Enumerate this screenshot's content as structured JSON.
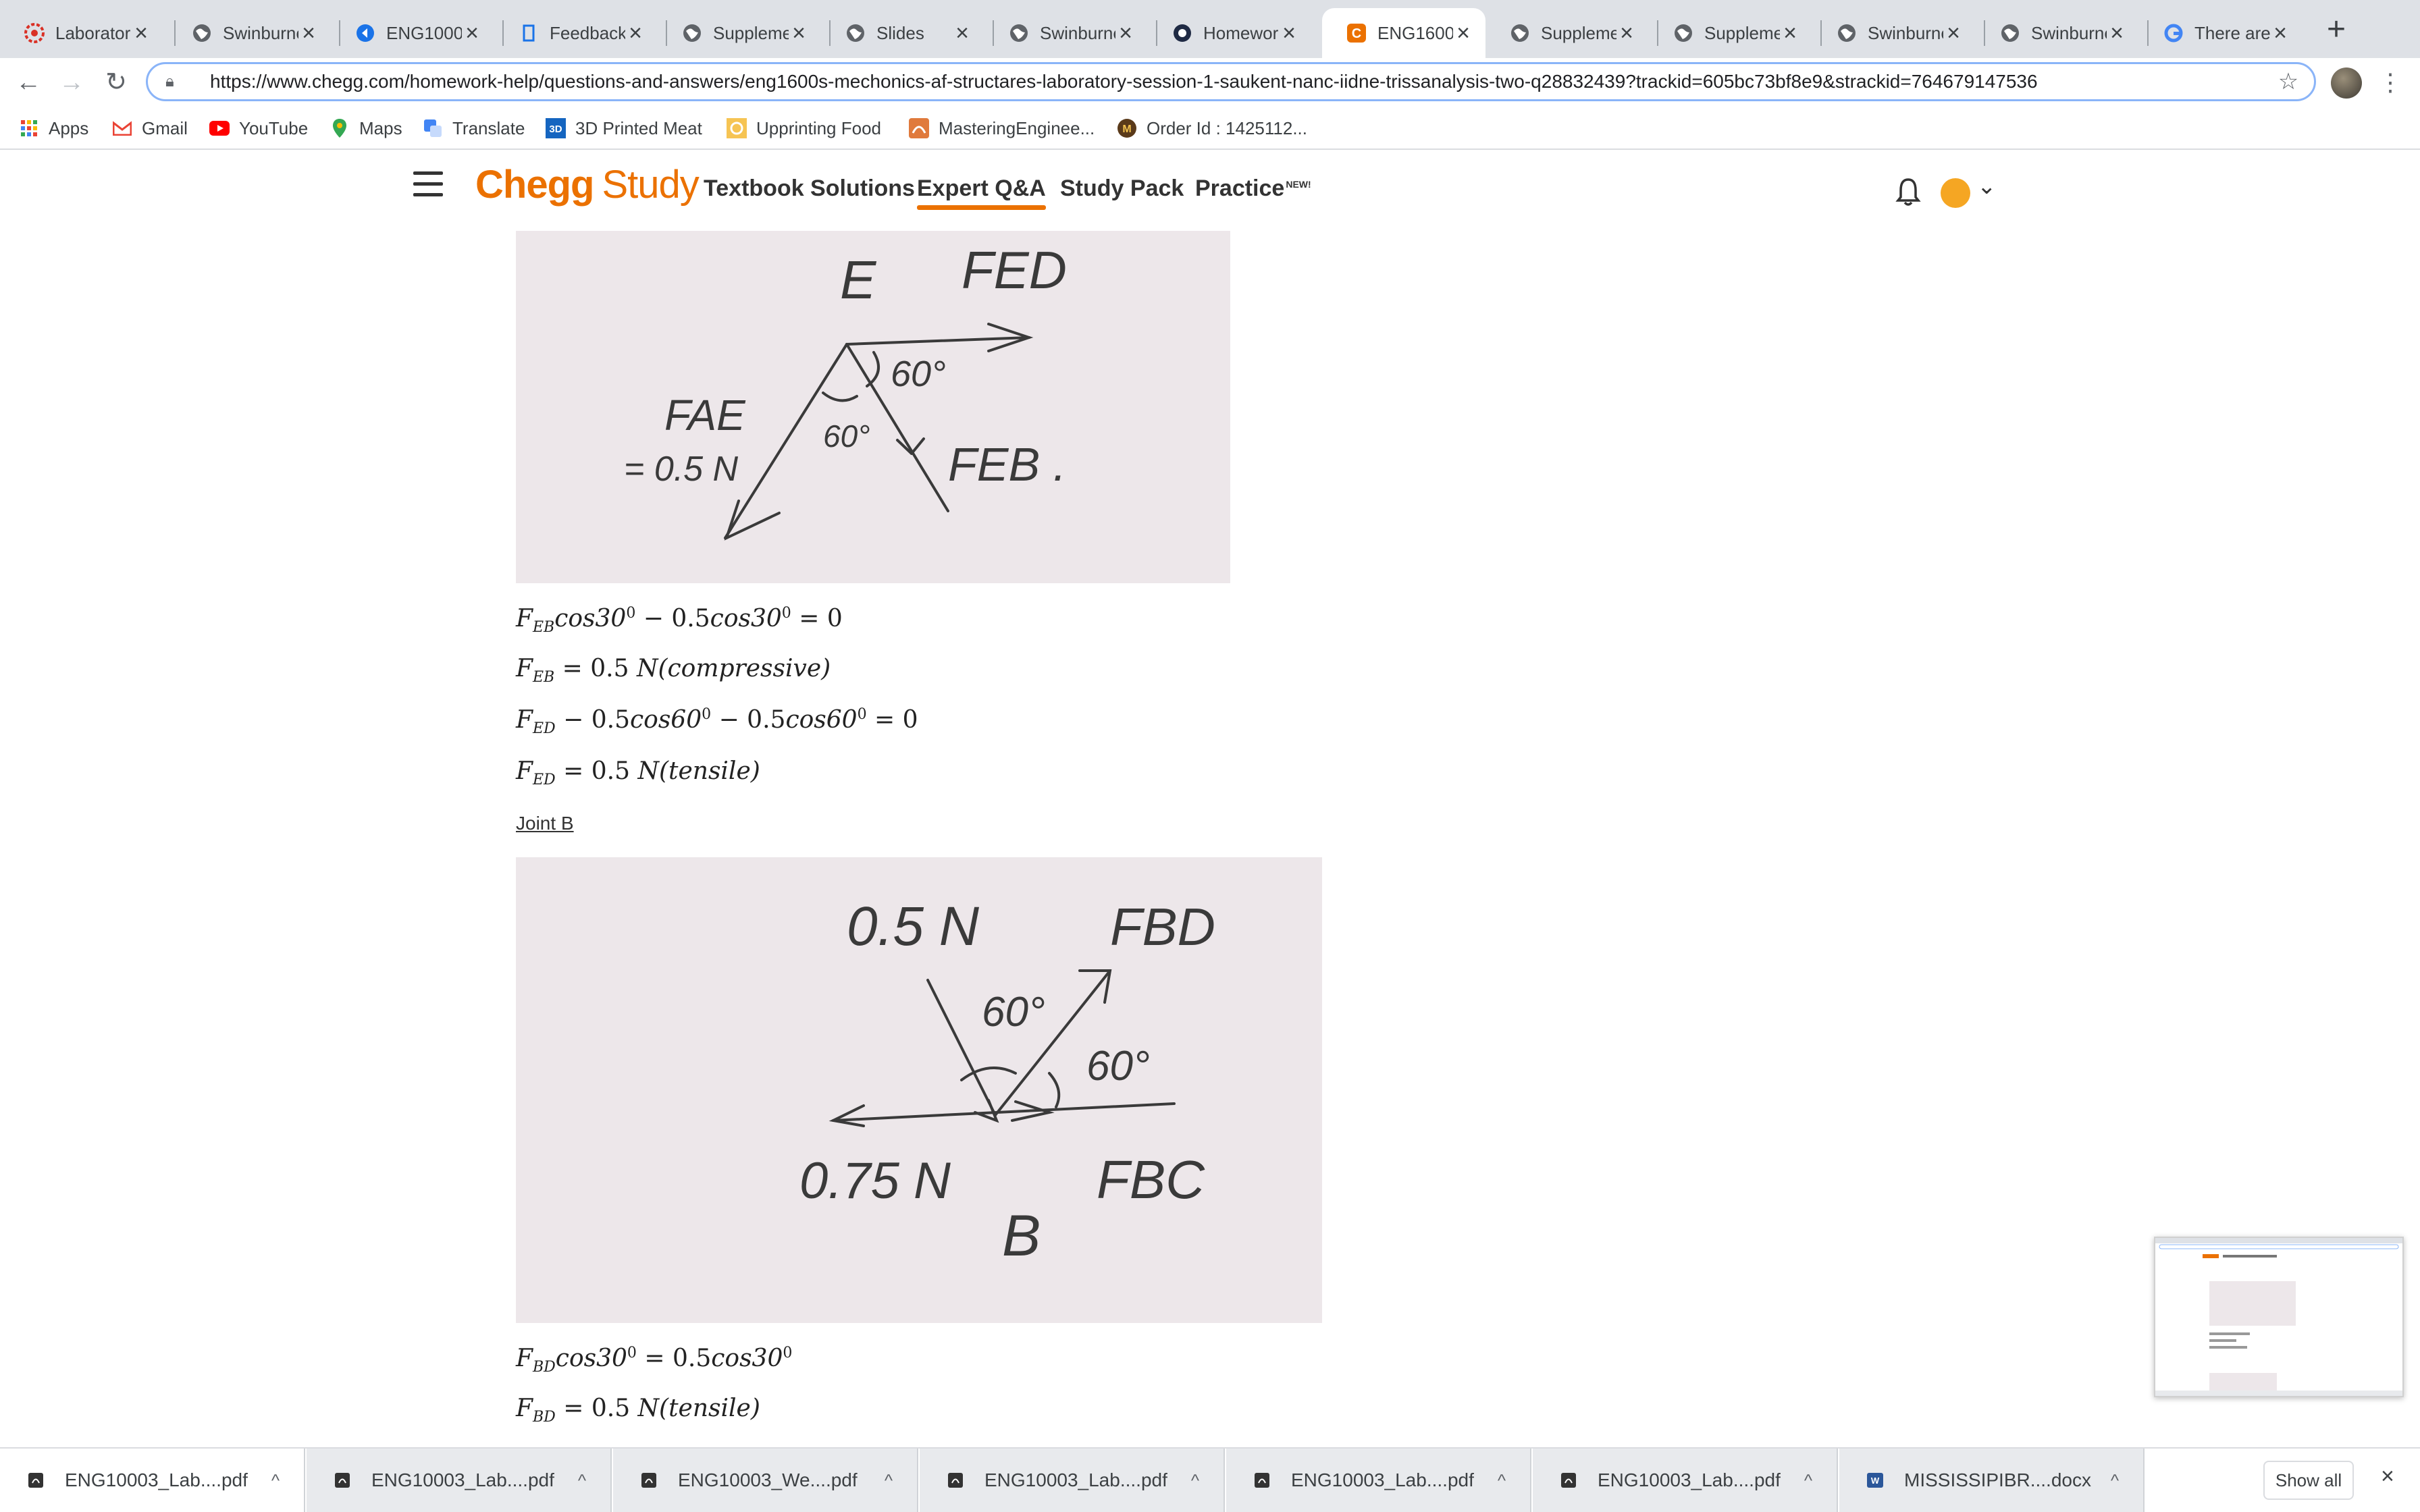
{
  "browser": {
    "tabs": [
      {
        "title": "Laborator",
        "icon": "gear-red-icon"
      },
      {
        "title": "Swinburne",
        "icon": "globe-icon"
      },
      {
        "title": "ENG1000",
        "icon": "arrow-circle-icon"
      },
      {
        "title": "Feedback",
        "icon": "feedback-icon"
      },
      {
        "title": "Suppleme",
        "icon": "globe-icon"
      },
      {
        "title": "Slides",
        "icon": "globe-icon"
      },
      {
        "title": "Swinburne",
        "icon": "globe-icon"
      },
      {
        "title": "Homework",
        "icon": "homework-icon"
      },
      {
        "title": "ENG1600",
        "icon": "chegg-icon"
      },
      {
        "title": "Suppleme",
        "icon": "globe-icon"
      },
      {
        "title": "Suppleme",
        "icon": "globe-icon"
      },
      {
        "title": "Swinburne",
        "icon": "globe-icon"
      },
      {
        "title": "Swinburne",
        "icon": "globe-icon"
      },
      {
        "title": "There are",
        "icon": "google-icon"
      }
    ],
    "url": "https://www.chegg.com/homework-help/questions-and-answers/eng1600s-mechonics-af-structares-laboratory-session-1-saukent-nanc-iidne-trissanalysis-two-q28832439?trackid=605bc73bf8e9&strackid=764679147536",
    "bookmarks": [
      "Apps",
      "Gmail",
      "YouTube",
      "Maps",
      "Translate",
      "3D Printed Meat",
      "Upprinting Food",
      "MasteringEnginee...",
      "Order Id : 1425112..."
    ]
  },
  "chegg": {
    "logo_main": "Chegg",
    "logo_sub": "Study",
    "nav": {
      "textbook": "Textbook Solutions",
      "expert": "Expert Q&A",
      "studypack": "Study Pack",
      "practice": "Practice",
      "practice_badge": "NEW!"
    },
    "accent": "#eb7100"
  },
  "content": {
    "sketch1_labels": {
      "E": "E",
      "FED": "FED",
      "angle_top": "60°",
      "angle_left": "60°",
      "FAE": "FAE",
      "FAE_val": "= 0.5 N",
      "FEB": "FEB ."
    },
    "eq1": {
      "a": "F",
      "a_sub": "EB",
      "b": "cos30",
      "b_sup": "0",
      "c": " − 0.5",
      "d": "cos30",
      "d_sup": "0",
      "e": " = 0"
    },
    "eq2": {
      "a": "F",
      "a_sub": "EB",
      "b": " = 0.5 ",
      "c": "N",
      "d": "(compressive)"
    },
    "eq3": {
      "a": "F",
      "a_sub": "ED",
      "b": " − 0.5",
      "c": "cos60",
      "c_sup": "0",
      "d": " − 0.5",
      "e": "cos60",
      "e_sup": "0",
      "f": " = 0"
    },
    "eq4": {
      "a": "F",
      "a_sub": "ED",
      "b": " = 0.5 ",
      "c": "N",
      "d": "(tensile)"
    },
    "joint_b": "Joint B",
    "sketch2_labels": {
      "load": "0.5 N",
      "FBD": "FBD",
      "angle1": "60°",
      "angle2": "60°",
      "left": "0.75 N",
      "FBC": "FBC",
      "B": "B"
    },
    "eq5": {
      "a": "F",
      "a_sub": "BD",
      "b": "cos30",
      "b_sup": "0",
      "c": " = 0.5",
      "d": "cos30",
      "d_sup": "0"
    },
    "eq6": {
      "a": "F",
      "a_sub": "BD",
      "b": " = 0.5 ",
      "c": "N",
      "d": "(tensile)"
    }
  },
  "downloads": {
    "items": [
      "ENG10003_Lab....pdf",
      "ENG10003_Lab....pdf",
      "ENG10003_We....pdf",
      "ENG10003_Lab....pdf",
      "ENG10003_Lab....pdf",
      "ENG10003_Lab....pdf",
      "MISSISSIPIBR....docx"
    ],
    "show_all": "Show all"
  }
}
